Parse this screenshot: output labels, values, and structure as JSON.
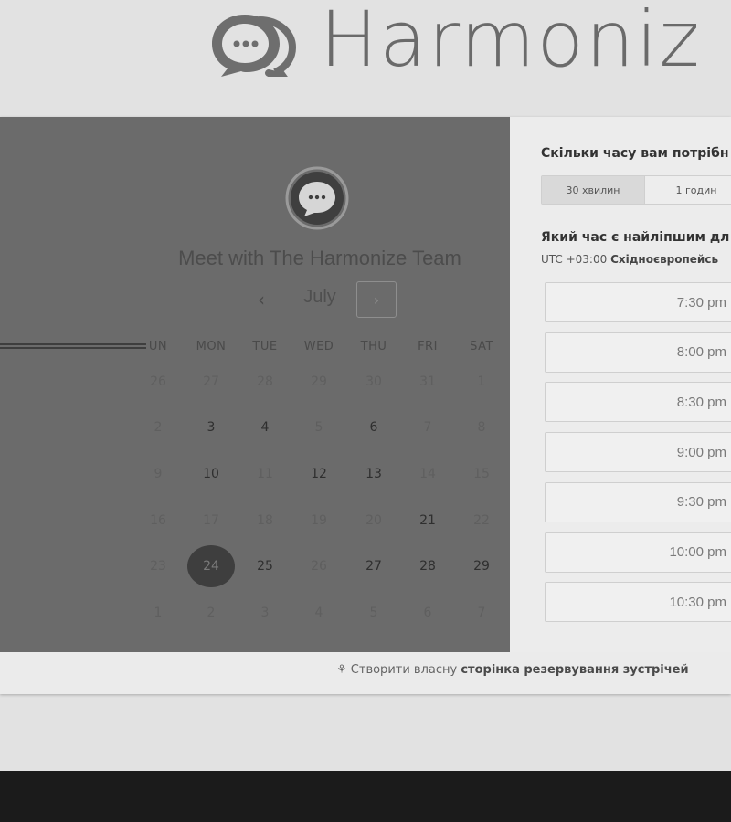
{
  "brand": {
    "name": "Harmoniz"
  },
  "left_panel": {
    "title": "Meet with The Harmonize Team",
    "month": "July",
    "prev": "‹",
    "next": "›",
    "weekdays": [
      "UN",
      "MON",
      "TUE",
      "WED",
      "THU",
      "FRI",
      "SAT"
    ],
    "weeks": [
      [
        {
          "d": "26",
          "s": "muted"
        },
        {
          "d": "27",
          "s": "muted"
        },
        {
          "d": "28",
          "s": "muted"
        },
        {
          "d": "29",
          "s": "muted"
        },
        {
          "d": "30",
          "s": "muted"
        },
        {
          "d": "31",
          "s": "muted"
        },
        {
          "d": "1",
          "s": "muted"
        }
      ],
      [
        {
          "d": "2",
          "s": "muted"
        },
        {
          "d": "3",
          "s": "avail"
        },
        {
          "d": "4",
          "s": "avail"
        },
        {
          "d": "5",
          "s": "muted"
        },
        {
          "d": "6",
          "s": "avail"
        },
        {
          "d": "7",
          "s": "muted"
        },
        {
          "d": "8",
          "s": "muted"
        }
      ],
      [
        {
          "d": "9",
          "s": "muted"
        },
        {
          "d": "10",
          "s": "avail"
        },
        {
          "d": "11",
          "s": "muted"
        },
        {
          "d": "12",
          "s": "avail"
        },
        {
          "d": "13",
          "s": "avail"
        },
        {
          "d": "14",
          "s": "muted"
        },
        {
          "d": "15",
          "s": "muted"
        }
      ],
      [
        {
          "d": "16",
          "s": "muted"
        },
        {
          "d": "17",
          "s": "muted"
        },
        {
          "d": "18",
          "s": "muted"
        },
        {
          "d": "19",
          "s": "muted"
        },
        {
          "d": "20",
          "s": "muted"
        },
        {
          "d": "21",
          "s": "avail"
        },
        {
          "d": "22",
          "s": "muted"
        }
      ],
      [
        {
          "d": "23",
          "s": "muted"
        },
        {
          "d": "24",
          "s": "sel"
        },
        {
          "d": "25",
          "s": "avail"
        },
        {
          "d": "26",
          "s": "muted"
        },
        {
          "d": "27",
          "s": "avail"
        },
        {
          "d": "28",
          "s": "avail"
        },
        {
          "d": "29",
          "s": "avail"
        }
      ],
      [
        {
          "d": "1",
          "s": "muted"
        },
        {
          "d": "2",
          "s": "muted"
        },
        {
          "d": "3",
          "s": "muted"
        },
        {
          "d": "4",
          "s": "muted"
        },
        {
          "d": "5",
          "s": "muted"
        },
        {
          "d": "6",
          "s": "muted"
        },
        {
          "d": "7",
          "s": "muted"
        }
      ]
    ]
  },
  "right_panel": {
    "duration_question": "Скільки часу вам потрібн",
    "durations": [
      "30 хвилин",
      "1 годин"
    ],
    "time_question": "Який час є найліпшим дл",
    "timezone_prefix": "UTC +03:00",
    "timezone_name": "Східноєвропейсь",
    "slots": [
      "7:30 pm",
      "8:00 pm",
      "8:30 pm",
      "9:00 pm",
      "9:30 pm",
      "10:00 pm",
      "10:30 pm"
    ]
  },
  "footer": {
    "link_prefix": "Створити власну",
    "link_bold": "сторінка резервування зустрічей"
  },
  "colors": {
    "panel": "#6b6b6b",
    "selected_day": "#3e3e3e",
    "bottom_bar": "#1b1b1b"
  }
}
